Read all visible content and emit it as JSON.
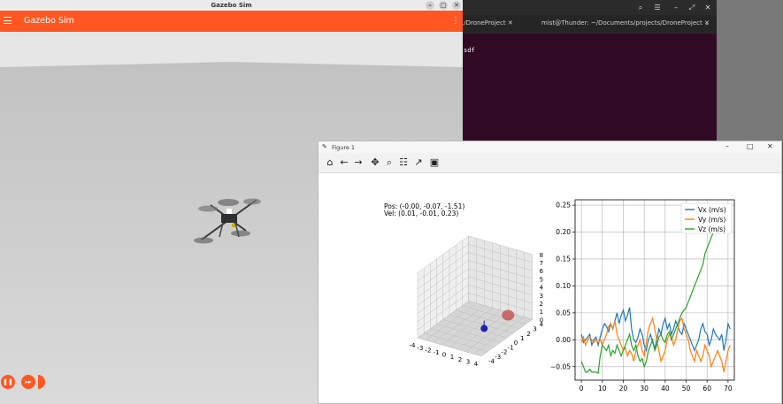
{
  "terminal": {
    "tab1": "./DroneProject",
    "tab2": "mist@Thunder: ~/Documents/projects/DroneProject",
    "text": "sdf"
  },
  "gazebo": {
    "window_title": "Gazebo Sim",
    "app_name": "Gazebo Sim",
    "menu_icon": "hamburger-icon",
    "more_icon": "kebab-icon"
  },
  "figure": {
    "window_title": "Figure 1",
    "toolbar": [
      "home-icon",
      "back-icon",
      "forward-icon",
      "pan-icon",
      "zoom-icon",
      "configure-icon",
      "edit-axes-icon",
      "save-icon"
    ],
    "pos_text": "Pos: (-0.00, -0.07, -1.51)",
    "vel_text": "Vel: (0.01, -0.01, 0.23)"
  },
  "colors": {
    "gazebo_orange": "#ff5722",
    "terminal_bg": "#300a24",
    "vx": "#1f77b4",
    "vy": "#ff7f0e",
    "vz": "#2ca02c"
  },
  "chart_data": [
    {
      "type": "scatter3d",
      "x_ticks": [
        "-4",
        "-3",
        "-2",
        "-1",
        "0",
        "1",
        "2",
        "3",
        "4"
      ],
      "y_ticks": [
        "-4",
        "-3",
        "-2",
        "-1",
        "0",
        "1",
        "2",
        "3",
        "4"
      ],
      "z_ticks": [
        "0",
        "1",
        "2",
        "3",
        "4",
        "5",
        "6",
        "7",
        "8"
      ],
      "xlim": [
        -4,
        4
      ],
      "ylim": [
        -4,
        4
      ],
      "zlim": [
        0,
        8
      ],
      "points": [
        {
          "name": "target",
          "color": "#c0504d"
        },
        {
          "name": "drone",
          "color": "#1f1fb4"
        }
      ]
    },
    {
      "type": "line",
      "xlim": [
        -3,
        73
      ],
      "ylim": [
        -0.075,
        0.26
      ],
      "x_ticks": [
        0,
        10,
        20,
        30,
        40,
        50,
        60,
        70
      ],
      "y_ticks": [
        0.25,
        0.2,
        0.15,
        0.1,
        0.05,
        0.0,
        -0.05
      ],
      "y_tick_labels": [
        "0.25",
        "0.20",
        "0.15",
        "0.10",
        "0.05",
        "0.00",
        "−0.05"
      ],
      "legend_position": "top-right",
      "series": [
        {
          "name": "Vx (m/s)",
          "color": "#1f77b4",
          "points": [
            [
              0,
              0.01
            ],
            [
              1,
              -0.005
            ],
            [
              2,
              0.0
            ],
            [
              3,
              0.005
            ],
            [
              4,
              0.01
            ],
            [
              5,
              -0.01
            ],
            [
              6,
              0.0
            ],
            [
              7,
              0.005
            ],
            [
              8,
              -0.01
            ],
            [
              9,
              0.005
            ],
            [
              10,
              0.02
            ],
            [
              11,
              0.03
            ],
            [
              12,
              0.025
            ],
            [
              13,
              0.015
            ],
            [
              14,
              0.03
            ],
            [
              15,
              0.02
            ],
            [
              16,
              0.035
            ],
            [
              17,
              0.05
            ],
            [
              18,
              0.03
            ],
            [
              19,
              0.045
            ],
            [
              20,
              0.055
            ],
            [
              21,
              0.035
            ],
            [
              22,
              0.045
            ],
            [
              23,
              0.06
            ],
            [
              24,
              0.02
            ],
            [
              25,
              0.0
            ],
            [
              26,
              -0.005
            ],
            [
              27,
              0.005
            ],
            [
              28,
              0.02
            ],
            [
              29,
              0.01
            ],
            [
              30,
              -0.01
            ],
            [
              31,
              -0.02
            ],
            [
              32,
              0.0
            ],
            [
              33,
              0.01
            ],
            [
              34,
              -0.005
            ],
            [
              35,
              -0.015
            ],
            [
              36,
              0.0
            ],
            [
              37,
              0.02
            ],
            [
              38,
              0.01
            ],
            [
              39,
              0.03
            ],
            [
              40,
              0.04
            ],
            [
              41,
              0.02
            ],
            [
              42,
              0.03
            ],
            [
              43,
              0.01
            ],
            [
              44,
              0.02
            ],
            [
              45,
              0.035
            ],
            [
              46,
              0.025
            ],
            [
              47,
              0.015
            ],
            [
              48,
              0.01
            ],
            [
              49,
              0.03
            ],
            [
              50,
              0.02
            ],
            [
              51,
              0.01
            ],
            [
              52,
              0.0
            ],
            [
              53,
              -0.01
            ],
            [
              54,
              -0.02
            ],
            [
              55,
              -0.01
            ],
            [
              56,
              0.0
            ],
            [
              57,
              0.02
            ],
            [
              58,
              0.03
            ],
            [
              59,
              0.015
            ],
            [
              60,
              0.01
            ],
            [
              61,
              -0.01
            ],
            [
              62,
              0.0
            ],
            [
              63,
              0.02
            ],
            [
              64,
              0.01
            ],
            [
              65,
              0.005
            ],
            [
              66,
              0.0
            ],
            [
              67,
              0.01
            ],
            [
              68,
              -0.02
            ],
            [
              69,
              0.0
            ],
            [
              70,
              0.03
            ],
            [
              71,
              0.02
            ]
          ]
        },
        {
          "name": "Vy (m/s)",
          "color": "#ff7f0e",
          "points": [
            [
              0,
              -0.005
            ],
            [
              1,
              0.005
            ],
            [
              2,
              -0.01
            ],
            [
              3,
              0.0
            ],
            [
              4,
              0.005
            ],
            [
              5,
              0.0
            ],
            [
              6,
              -0.005
            ],
            [
              7,
              0.0
            ],
            [
              8,
              -0.005
            ],
            [
              9,
              0.0
            ],
            [
              10,
              -0.01
            ],
            [
              11,
              0.0
            ],
            [
              12,
              0.01
            ],
            [
              13,
              0.025
            ],
            [
              14,
              0.03
            ],
            [
              15,
              0.02
            ],
            [
              16,
              0.035
            ],
            [
              17,
              0.01
            ],
            [
              18,
              0.0
            ],
            [
              19,
              -0.01
            ],
            [
              20,
              -0.02
            ],
            [
              21,
              -0.015
            ],
            [
              22,
              -0.03
            ],
            [
              23,
              -0.02
            ],
            [
              24,
              -0.025
            ],
            [
              25,
              -0.04
            ],
            [
              26,
              -0.02
            ],
            [
              27,
              -0.01
            ],
            [
              28,
              0.0
            ],
            [
              29,
              -0.02
            ],
            [
              30,
              -0.03
            ],
            [
              31,
              -0.005
            ],
            [
              32,
              0.02
            ],
            [
              33,
              0.03
            ],
            [
              34,
              0.04
            ],
            [
              35,
              0.02
            ],
            [
              36,
              0.0
            ],
            [
              37,
              -0.02
            ],
            [
              38,
              -0.04
            ],
            [
              39,
              -0.03
            ],
            [
              40,
              -0.02
            ],
            [
              41,
              0.0
            ],
            [
              42,
              0.01
            ],
            [
              43,
              0.005
            ],
            [
              44,
              -0.01
            ],
            [
              45,
              0.0
            ],
            [
              46,
              0.02
            ],
            [
              47,
              0.035
            ],
            [
              48,
              0.04
            ],
            [
              49,
              0.02
            ],
            [
              50,
              0.01
            ],
            [
              51,
              0.0
            ],
            [
              52,
              -0.02
            ],
            [
              53,
              -0.03
            ],
            [
              54,
              -0.04
            ],
            [
              55,
              -0.02
            ],
            [
              56,
              -0.03
            ],
            [
              57,
              -0.04
            ],
            [
              58,
              -0.03
            ],
            [
              59,
              -0.01
            ],
            [
              60,
              -0.02
            ],
            [
              61,
              -0.03
            ],
            [
              62,
              -0.05
            ],
            [
              63,
              -0.04
            ],
            [
              64,
              -0.03
            ],
            [
              65,
              -0.02
            ],
            [
              66,
              -0.03
            ],
            [
              67,
              -0.04
            ],
            [
              68,
              -0.06
            ],
            [
              69,
              -0.04
            ],
            [
              70,
              -0.02
            ],
            [
              71,
              -0.01
            ]
          ]
        },
        {
          "name": "Vz (m/s)",
          "color": "#2ca02c",
          "points": [
            [
              0,
              -0.04
            ],
            [
              1,
              -0.05
            ],
            [
              2,
              -0.06
            ],
            [
              3,
              -0.06
            ],
            [
              4,
              -0.055
            ],
            [
              5,
              -0.06
            ],
            [
              6,
              -0.06
            ],
            [
              7,
              -0.06
            ],
            [
              8,
              -0.062
            ],
            [
              9,
              -0.03
            ],
            [
              10,
              -0.01
            ],
            [
              11,
              -0.015
            ],
            [
              12,
              -0.02
            ],
            [
              13,
              -0.01
            ],
            [
              14,
              -0.03
            ],
            [
              15,
              -0.02
            ],
            [
              16,
              -0.025
            ],
            [
              17,
              -0.01
            ],
            [
              18,
              -0.02
            ],
            [
              19,
              -0.03
            ],
            [
              20,
              -0.02
            ],
            [
              21,
              -0.01
            ],
            [
              22,
              0.0
            ],
            [
              23,
              0.01
            ],
            [
              24,
              -0.01
            ],
            [
              25,
              -0.02
            ],
            [
              26,
              -0.01
            ],
            [
              27,
              -0.03
            ],
            [
              28,
              -0.04
            ],
            [
              29,
              -0.035
            ],
            [
              30,
              -0.05
            ],
            [
              31,
              -0.04
            ],
            [
              32,
              -0.02
            ],
            [
              33,
              -0.01
            ],
            [
              34,
              0.0
            ],
            [
              35,
              -0.02
            ],
            [
              36,
              -0.01
            ],
            [
              37,
              0.005
            ],
            [
              38,
              0.01
            ],
            [
              39,
              0.0
            ],
            [
              40,
              -0.005
            ],
            [
              41,
              0.01
            ],
            [
              42,
              0.015
            ],
            [
              43,
              0.0
            ],
            [
              44,
              0.01
            ],
            [
              45,
              0.02
            ],
            [
              46,
              0.03
            ],
            [
              47,
              0.04
            ],
            [
              48,
              0.05
            ],
            [
              49,
              0.055
            ],
            [
              50,
              0.06
            ],
            [
              51,
              0.07
            ],
            [
              52,
              0.08
            ],
            [
              53,
              0.09
            ],
            [
              54,
              0.1
            ],
            [
              55,
              0.11
            ],
            [
              56,
              0.12
            ],
            [
              57,
              0.13
            ],
            [
              58,
              0.14
            ],
            [
              59,
              0.16
            ],
            [
              60,
              0.17
            ],
            [
              61,
              0.18
            ],
            [
              62,
              0.19
            ],
            [
              63,
              0.2
            ],
            [
              64,
              0.21
            ],
            [
              65,
              0.21
            ],
            [
              66,
              0.22
            ],
            [
              67,
              0.23
            ],
            [
              68,
              0.24
            ],
            [
              69,
              0.235
            ],
            [
              70,
              0.245
            ],
            [
              71,
              0.25
            ]
          ]
        }
      ]
    }
  ]
}
